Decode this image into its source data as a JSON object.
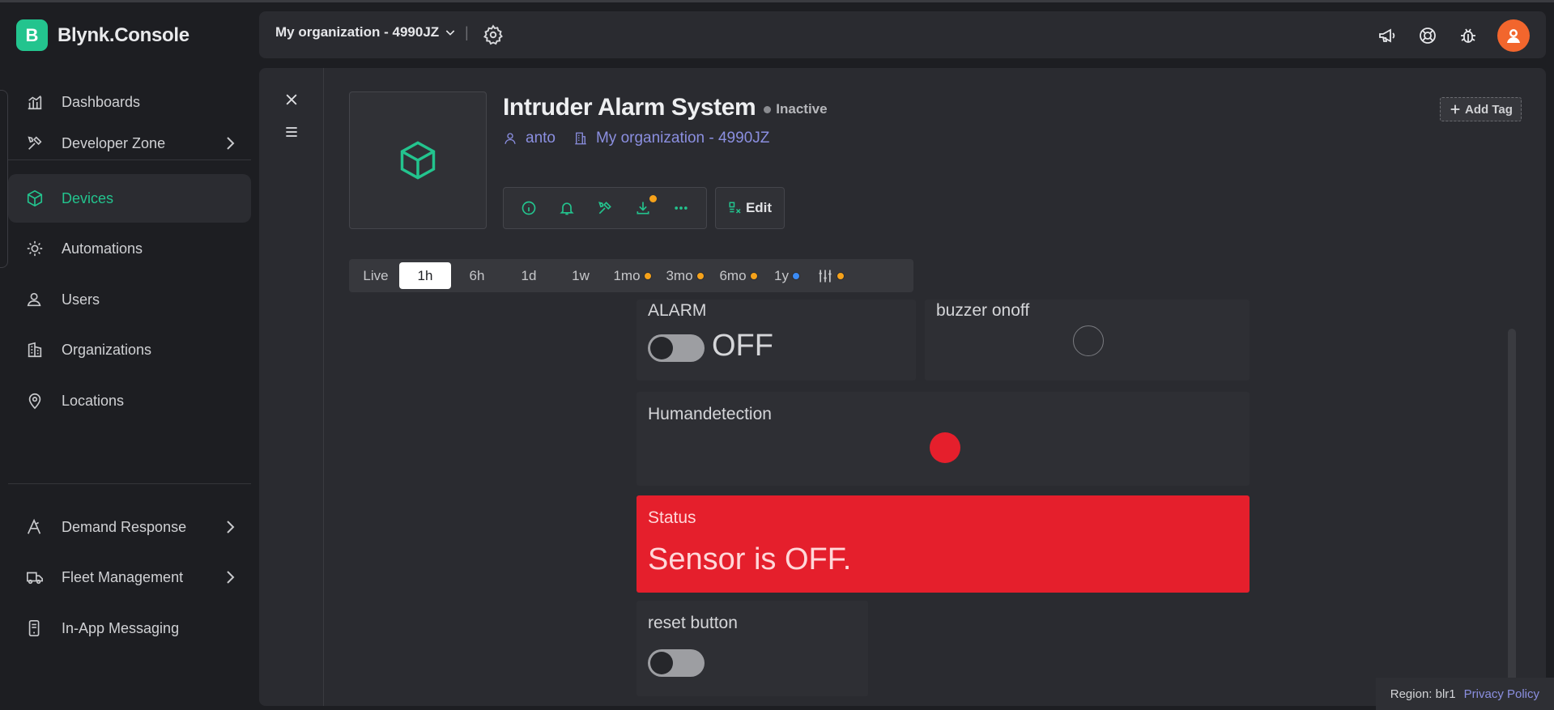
{
  "app": {
    "logo_letter": "B",
    "name": "Blynk.Console"
  },
  "sidebar": {
    "items": [
      {
        "label": "Dashboards",
        "icon": "dashboards-icon"
      },
      {
        "label": "Developer Zone",
        "icon": "developer-zone-icon",
        "has_submenu": true
      },
      {
        "label": "Devices",
        "icon": "devices-icon",
        "active": true
      },
      {
        "label": "Automations",
        "icon": "automations-icon"
      },
      {
        "label": "Users",
        "icon": "users-icon"
      },
      {
        "label": "Organizations",
        "icon": "organizations-icon"
      },
      {
        "label": "Locations",
        "icon": "locations-icon"
      },
      {
        "label": "Demand Response",
        "icon": "demand-response-icon",
        "has_submenu": true
      },
      {
        "label": "Fleet Management",
        "icon": "fleet-management-icon",
        "has_submenu": true
      },
      {
        "label": "In-App Messaging",
        "icon": "in-app-messaging-icon"
      }
    ]
  },
  "header": {
    "org_name": "My organization - 4990JZ",
    "separator": "|",
    "icons": [
      "announcement-icon",
      "help-lifebuoy-icon",
      "bug-report-icon",
      "user-avatar"
    ]
  },
  "device": {
    "name": "Intruder Alarm System",
    "status": "Inactive",
    "owner": "anto",
    "organization": "My organization - 4990JZ",
    "actions": [
      "info-icon",
      "notifications-bell-icon",
      "tools-icon",
      "download-icon",
      "more-icon"
    ],
    "edit_label": "Edit",
    "add_tag_label": "Add Tag"
  },
  "time_ranges": {
    "options": [
      {
        "label": "Live"
      },
      {
        "label": "1h",
        "selected": true
      },
      {
        "label": "6h"
      },
      {
        "label": "1d"
      },
      {
        "label": "1w"
      },
      {
        "label": "1mo",
        "dot_color": "#f6a21a"
      },
      {
        "label": "3mo",
        "dot_color": "#f6a21a"
      },
      {
        "label": "6mo",
        "dot_color": "#f6a21a"
      },
      {
        "label": "1y",
        "dot_color": "#3b8bf5"
      }
    ],
    "custom_dot_color": "#f6a21a"
  },
  "widgets": {
    "alarm": {
      "label": "ALARM",
      "state_text": "OFF",
      "on": false
    },
    "buzzer": {
      "label": "buzzer onoff",
      "led_on": false
    },
    "human": {
      "label": "Humandetection",
      "led_color": "#e51f2c"
    },
    "status": {
      "label": "Status",
      "value": "Sensor is OFF.",
      "bg_color": "#e51f2c"
    },
    "reset": {
      "label": "reset button",
      "on": false
    }
  },
  "footer": {
    "region": "Region: blr1",
    "privacy": "Privacy Policy"
  },
  "colors": {
    "accent": "#23c48e",
    "link": "#8b8fe0",
    "alert": "#e51f2c"
  }
}
